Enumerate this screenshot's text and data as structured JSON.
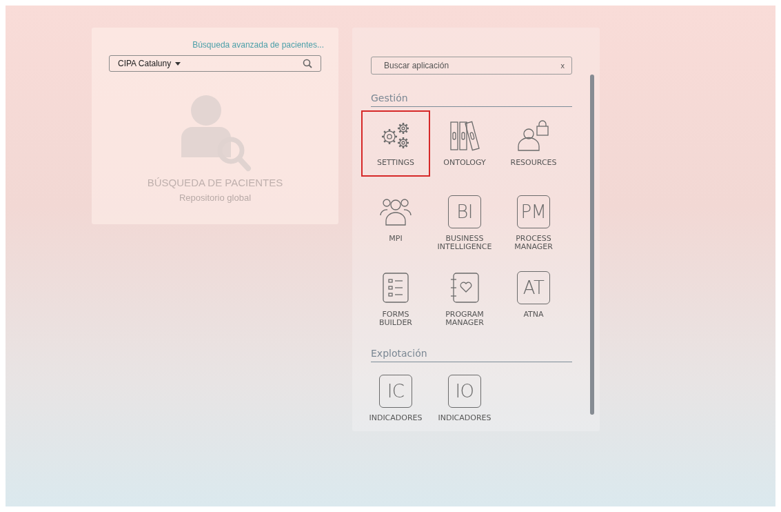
{
  "patient_search": {
    "advanced_link": "Búsqueda avanzada de pacientes...",
    "scope": "CIPA Cataluny",
    "title": "BÚSQUEDA DE PACIENTES",
    "subtitle": "Repositorio global"
  },
  "app_launcher": {
    "search": {
      "placeholder": "Buscar aplicación",
      "clear": "x"
    },
    "sections": [
      {
        "title": "Gestión",
        "apps": [
          {
            "kind": "gears",
            "lines": [
              "SETTINGS"
            ],
            "selected": true
          },
          {
            "kind": "binders",
            "lines": [
              "ONTOLOGY"
            ],
            "selected": false
          },
          {
            "kind": "user-lock",
            "lines": [
              "RESOURCES"
            ],
            "selected": false
          },
          {
            "kind": "group",
            "lines": [
              "MPI"
            ],
            "selected": false
          },
          {
            "kind": "abbr",
            "abbr": "BI",
            "lines": [
              "BUSINESS",
              "INTELLIGENCE"
            ],
            "selected": false
          },
          {
            "kind": "abbr",
            "abbr": "PM",
            "lines": [
              "PROCESS",
              "MANAGER"
            ],
            "selected": false
          },
          {
            "kind": "form",
            "lines": [
              "FORMS",
              "BUILDER"
            ],
            "selected": false
          },
          {
            "kind": "notebook",
            "lines": [
              "PROGRAM",
              "MANAGER"
            ],
            "selected": false
          },
          {
            "kind": "abbr",
            "abbr": "AT",
            "lines": [
              "ATNA"
            ],
            "selected": false
          }
        ]
      },
      {
        "title": "Explotación",
        "apps": [
          {
            "kind": "abbr",
            "abbr": "IC",
            "lines": [
              "INDICADORES"
            ],
            "selected": false
          },
          {
            "kind": "abbr",
            "abbr": "IO",
            "lines": [
              "INDICADORES"
            ],
            "selected": false
          }
        ]
      }
    ]
  }
}
